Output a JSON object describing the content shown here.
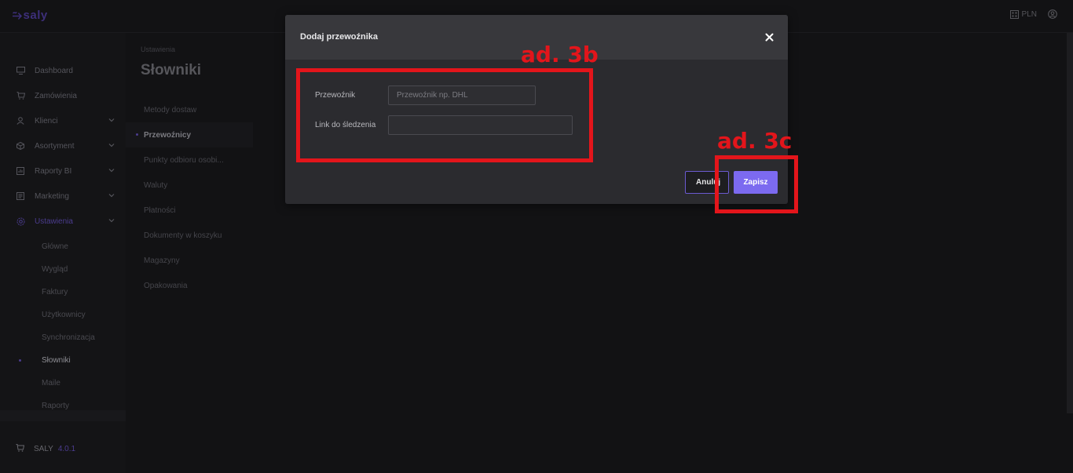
{
  "app": {
    "logo_text": "saly",
    "currency": "PLN"
  },
  "sidebar": {
    "items": [
      {
        "label": "Dashboard",
        "icon": "monitor-icon"
      },
      {
        "label": "Zamówienia",
        "icon": "cart-icon"
      },
      {
        "label": "Klienci",
        "icon": "user-icon",
        "expandable": true
      },
      {
        "label": "Asortyment",
        "icon": "box-icon",
        "expandable": true
      },
      {
        "label": "Raporty BI",
        "icon": "report-icon",
        "expandable": true
      },
      {
        "label": "Marketing",
        "icon": "marketing-icon",
        "expandable": true
      },
      {
        "label": "Ustawienia",
        "icon": "gear-icon",
        "expandable": true,
        "active": true
      }
    ],
    "sub_items": [
      "Główne",
      "Wygląd",
      "Faktury",
      "Użytkownicy",
      "Synchronizacja",
      "Słowniki",
      "Maile",
      "Raporty"
    ],
    "active_sub_item": "Słowniki",
    "footer_label": "SALY",
    "version": "4.0.1"
  },
  "content": {
    "breadcrumb": "Ustawienia",
    "title": "Słowniki",
    "menu": [
      "Metody dostaw",
      "Przewoźnicy",
      "Punkty odbioru osobi...",
      "Waluty",
      "Płatności",
      "Dokumenty w koszyku",
      "Magazyny",
      "Opakowania"
    ],
    "active_menu": "Przewoźnicy"
  },
  "modal": {
    "title": "Dodaj przewoźnika",
    "close_symbol": "×",
    "carrier_label": "Przewoźnik",
    "carrier_placeholder": "Przewoźnik np. DHL",
    "carrier_value": "",
    "tracking_label": "Link do śledzenia",
    "tracking_value": "",
    "cancel_label": "Anuluj",
    "save_label": "Zapisz"
  },
  "annotations": {
    "box_b_label": "ad. 3b",
    "box_c_label": "ad. 3c",
    "color": "#e3151b"
  },
  "colors": {
    "accent": "#7c6af0",
    "background": "#121214",
    "modal_bg": "#2b2b2f",
    "annotation": "#e3151b"
  }
}
